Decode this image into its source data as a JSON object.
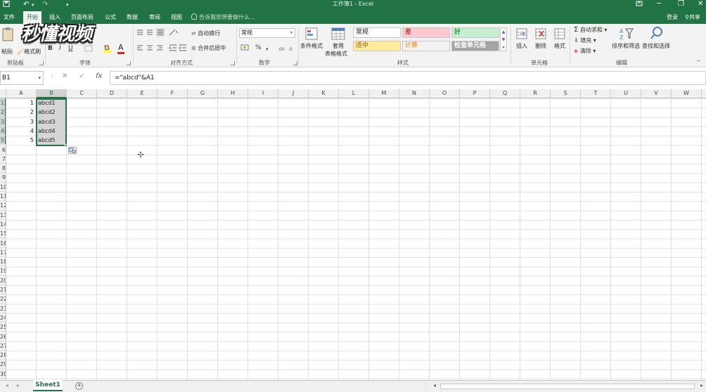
{
  "title_bar": {
    "title": "工作簿1 - Excel",
    "save_icon": "save-icon",
    "undo_icon": "undo-icon",
    "redo_icon": "redo-icon",
    "customize_icon": "customize-quick-access-icon"
  },
  "tabs": [
    {
      "label": "文件"
    },
    {
      "label": "开始",
      "active": true
    },
    {
      "label": "插入"
    },
    {
      "label": "页面布局"
    },
    {
      "label": "公式"
    },
    {
      "label": "数据"
    },
    {
      "label": "审阅"
    },
    {
      "label": "视图"
    }
  ],
  "tell_me_placeholder": "告诉我您想要做什么...",
  "account": {
    "sign_in": "登录",
    "share": "共享"
  },
  "watermark": "秒懂视频",
  "ribbon": {
    "clipboard": {
      "label": "剪贴板",
      "paste": "粘贴",
      "format_painter": "格式刷"
    },
    "font": {
      "label": "字体",
      "bold": "B",
      "italic": "I",
      "underline": "U",
      "font_color_letter": "A"
    },
    "alignment": {
      "label": "对齐方式",
      "wrap": "自动换行",
      "merge": "合并后居中"
    },
    "number": {
      "label": "数字",
      "format_value": "常规",
      "percent": "%",
      "comma": ","
    },
    "styles": {
      "label": "样式",
      "conditional": "条件格式",
      "table_format_1": "套用",
      "table_format_2": "表格格式",
      "cells": [
        {
          "label": "常规",
          "bg": "#ffffff",
          "color": "#222222"
        },
        {
          "label": "差",
          "bg": "#ffc7ce",
          "color": "#9c0006"
        },
        {
          "label": "好",
          "bg": "#c6efce",
          "color": "#006100"
        },
        {
          "label": "适中",
          "bg": "#ffeb9c",
          "color": "#9c5700"
        },
        {
          "label": "计算",
          "bg": "#f2f2f2",
          "color": "#fa7d00"
        },
        {
          "label": "检查单元格",
          "bg": "#a5a5a5",
          "color": "#ffffff"
        }
      ]
    },
    "cells": {
      "label": "单元格",
      "insert": "插入",
      "delete": "删除",
      "format": "格式"
    },
    "editing": {
      "label": "编辑",
      "autosum": "自动求和",
      "fill": "填充",
      "clear": "清除",
      "sort": "排序和筛选",
      "find": "查找和选择"
    }
  },
  "formula_bar": {
    "name_box": "B1",
    "cancel": "✕",
    "enter": "✓",
    "fx": "fx",
    "formula": "=\"abcd\"&A1"
  },
  "columns": [
    "A",
    "B",
    "C",
    "D",
    "E",
    "F",
    "G",
    "H",
    "I",
    "J",
    "K",
    "L",
    "M",
    "N",
    "O",
    "P",
    "Q",
    "R",
    "S",
    "T",
    "U",
    "V",
    "W"
  ],
  "selected_column": "B",
  "rows": [
    "1",
    "2",
    "3",
    "4",
    "5",
    "6",
    "7",
    "8",
    "9",
    "10",
    "11",
    "12",
    "13",
    "14",
    "15",
    "16",
    "17",
    "18",
    "19",
    "20",
    "21",
    "22",
    "23",
    "24",
    "25",
    "26",
    "27",
    "28",
    "29",
    "30"
  ],
  "cell_data": [
    {
      "row": 1,
      "a": "1",
      "b": "abcd1"
    },
    {
      "row": 2,
      "a": "2",
      "b": "abcd2"
    },
    {
      "row": 3,
      "a": "3",
      "b": "abcd3"
    },
    {
      "row": 4,
      "a": "4",
      "b": "abcd4"
    },
    {
      "row": 5,
      "a": "5",
      "b": "abcd5"
    }
  ],
  "sheets": [
    {
      "label": "Sheet1",
      "active": true
    }
  ],
  "accent": "#217346"
}
